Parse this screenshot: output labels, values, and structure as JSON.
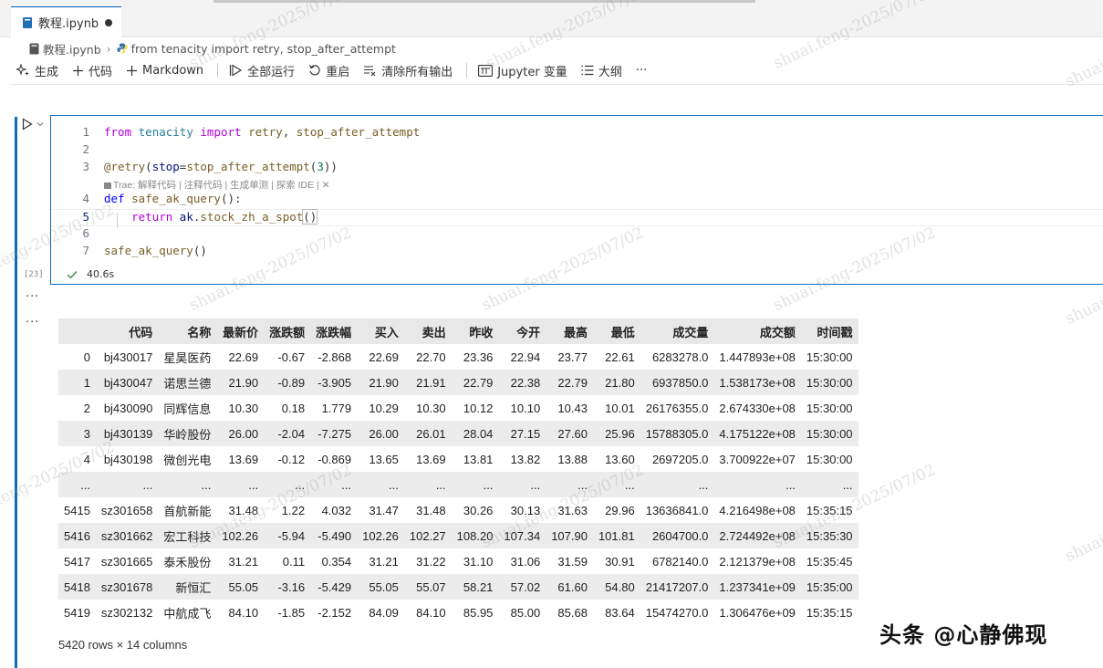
{
  "tab": {
    "title": "教程.ipynb"
  },
  "breadcrumb": {
    "file": "教程.ipynb",
    "cell": "from tenacity import retry, stop_after_attempt"
  },
  "toolbar": {
    "generate": "生成",
    "code": "代码",
    "markdown": "Markdown",
    "run_all": "全部运行",
    "restart": "重启",
    "clear_outputs": "清除所有输出",
    "variables": "Jupyter 变量",
    "outline": "大纲",
    "more": "···"
  },
  "cell": {
    "execution_count": "[23]",
    "duration": "40.6s",
    "codelens": "Trae: 解释代码 | 注释代码 | 生成单测 | 探索 IDE | ✕",
    "line_numbers": [
      "1",
      "2",
      "3",
      "4",
      "5",
      "6",
      "7"
    ]
  },
  "output": {
    "ellipsis": "···",
    "shape": "5420 rows × 14 columns",
    "columns": [
      "",
      "代码",
      "名称",
      "最新价",
      "涨跌额",
      "涨跌幅",
      "买入",
      "卖出",
      "昨收",
      "今开",
      "最高",
      "最低",
      "成交量",
      "成交额",
      "时间戳"
    ],
    "rows": [
      [
        "0",
        "bj430017",
        "星昊医药",
        "22.69",
        "-0.67",
        "-2.868",
        "22.69",
        "22.70",
        "23.36",
        "22.94",
        "23.77",
        "22.61",
        "6283278.0",
        "1.447893e+08",
        "15:30:00"
      ],
      [
        "1",
        "bj430047",
        "诺思兰德",
        "21.90",
        "-0.89",
        "-3.905",
        "21.90",
        "21.91",
        "22.79",
        "22.38",
        "22.79",
        "21.80",
        "6937850.0",
        "1.538173e+08",
        "15:30:00"
      ],
      [
        "2",
        "bj430090",
        "同辉信息",
        "10.30",
        "0.18",
        "1.779",
        "10.29",
        "10.30",
        "10.12",
        "10.10",
        "10.43",
        "10.01",
        "26176355.0",
        "2.674330e+08",
        "15:30:00"
      ],
      [
        "3",
        "bj430139",
        "华岭股份",
        "26.00",
        "-2.04",
        "-7.275",
        "26.00",
        "26.01",
        "28.04",
        "27.15",
        "27.60",
        "25.96",
        "15788305.0",
        "4.175122e+08",
        "15:30:00"
      ],
      [
        "4",
        "bj430198",
        "微创光电",
        "13.69",
        "-0.12",
        "-0.869",
        "13.65",
        "13.69",
        "13.81",
        "13.82",
        "13.88",
        "13.60",
        "2697205.0",
        "3.700922e+07",
        "15:30:00"
      ],
      [
        "...",
        "...",
        "...",
        "...",
        "...",
        "...",
        "...",
        "...",
        "...",
        "...",
        "...",
        "...",
        "...",
        "...",
        "..."
      ],
      [
        "5415",
        "sz301658",
        "首航新能",
        "31.48",
        "1.22",
        "4.032",
        "31.47",
        "31.48",
        "30.26",
        "30.13",
        "31.63",
        "29.96",
        "13636841.0",
        "4.216498e+08",
        "15:35:15"
      ],
      [
        "5416",
        "sz301662",
        "宏工科技",
        "102.26",
        "-5.94",
        "-5.490",
        "102.26",
        "102.27",
        "108.20",
        "107.34",
        "107.90",
        "101.81",
        "2604700.0",
        "2.724492e+08",
        "15:35:30"
      ],
      [
        "5417",
        "sz301665",
        "泰禾股份",
        "31.21",
        "0.11",
        "0.354",
        "31.21",
        "31.22",
        "31.10",
        "31.06",
        "31.59",
        "30.91",
        "6782140.0",
        "2.121379e+08",
        "15:35:45"
      ],
      [
        "5418",
        "sz301678",
        "新恒汇",
        "55.05",
        "-3.16",
        "-5.429",
        "55.05",
        "55.07",
        "58.21",
        "57.02",
        "61.60",
        "54.80",
        "21417207.0",
        "1.237341e+09",
        "15:35:00"
      ],
      [
        "5419",
        "sz302132",
        "中航成飞",
        "84.10",
        "-1.85",
        "-2.152",
        "84.09",
        "84.10",
        "85.95",
        "85.00",
        "85.68",
        "83.64",
        "15474270.0",
        "1.306476e+09",
        "15:35:15"
      ]
    ]
  },
  "watermark": "shuai.feng-2025/07/02",
  "brand": "头条 @心静佛现"
}
